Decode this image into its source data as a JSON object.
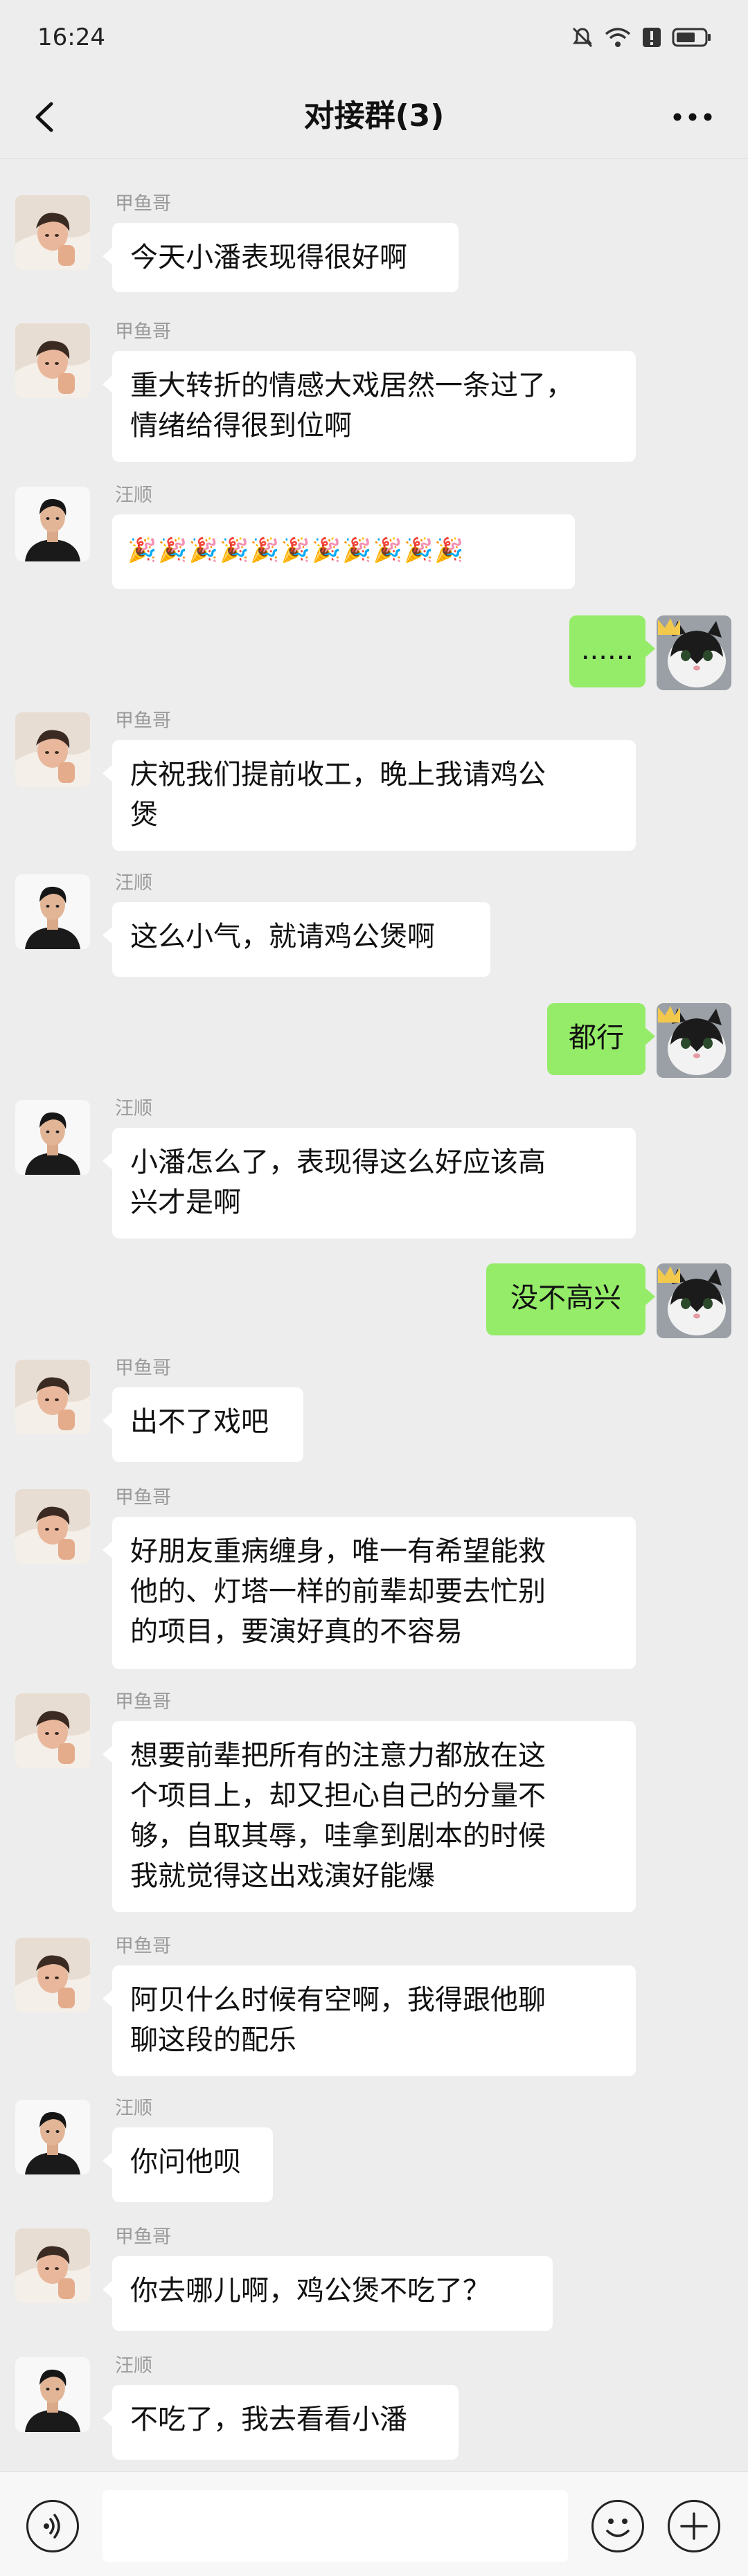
{
  "status_bar": {
    "time": "16:24"
  },
  "header": {
    "title": "对接群(3)"
  },
  "members": {
    "a": "甲鱼哥",
    "b": "汪顺"
  },
  "messages": [
    {
      "dir": "in",
      "sender": "甲鱼哥",
      "text": "今天小潘表现得很好啊"
    },
    {
      "dir": "in",
      "sender": "甲鱼哥",
      "text": "重大转折的情感大戏居然一条过了，\n情绪给得很到位啊"
    },
    {
      "dir": "in",
      "sender": "汪顺",
      "text": "🎉🎉🎉🎉🎉🎉🎉🎉🎉🎉🎉"
    },
    {
      "dir": "out",
      "text": "......"
    },
    {
      "dir": "in",
      "sender": "甲鱼哥",
      "text": "庆祝我们提前收工，晚上我请鸡公\n煲"
    },
    {
      "dir": "in",
      "sender": "汪顺",
      "text": "这么小气，就请鸡公煲啊"
    },
    {
      "dir": "out",
      "text": "都行"
    },
    {
      "dir": "in",
      "sender": "汪顺",
      "text": "小潘怎么了，表现得这么好应该高\n兴才是啊"
    },
    {
      "dir": "out",
      "text": "没不高兴"
    },
    {
      "dir": "in",
      "sender": "甲鱼哥",
      "text": "出不了戏吧"
    },
    {
      "dir": "in",
      "sender": "甲鱼哥",
      "text": "好朋友重病缠身，唯一有希望能救\n他的、灯塔一样的前辈却要去忙别\n的项目，要演好真的不容易"
    },
    {
      "dir": "in",
      "sender": "甲鱼哥",
      "text": "想要前辈把所有的注意力都放在这\n个项目上，却又担心自己的分量不\n够，自取其辱，哇拿到剧本的时候\n我就觉得这出戏演好能爆"
    },
    {
      "dir": "in",
      "sender": "甲鱼哥",
      "text": "阿贝什么时候有空啊，我得跟他聊\n聊这段的配乐"
    },
    {
      "dir": "in",
      "sender": "汪顺",
      "text": "你问他呗"
    },
    {
      "dir": "in",
      "sender": "甲鱼哥",
      "text": "你去哪儿啊，鸡公煲不吃了？"
    },
    {
      "dir": "in",
      "sender": "汪顺",
      "text": "不吃了，我去看看小潘"
    }
  ],
  "icons": {
    "back": "back-arrow-icon",
    "more": "more-dots-icon",
    "voice": "voice-icon",
    "emoji": "emoji-icon",
    "plus": "plus-icon"
  },
  "colors": {
    "out_bubble": "#95ec69",
    "in_bubble": "#ffffff",
    "background": "#ededed"
  }
}
